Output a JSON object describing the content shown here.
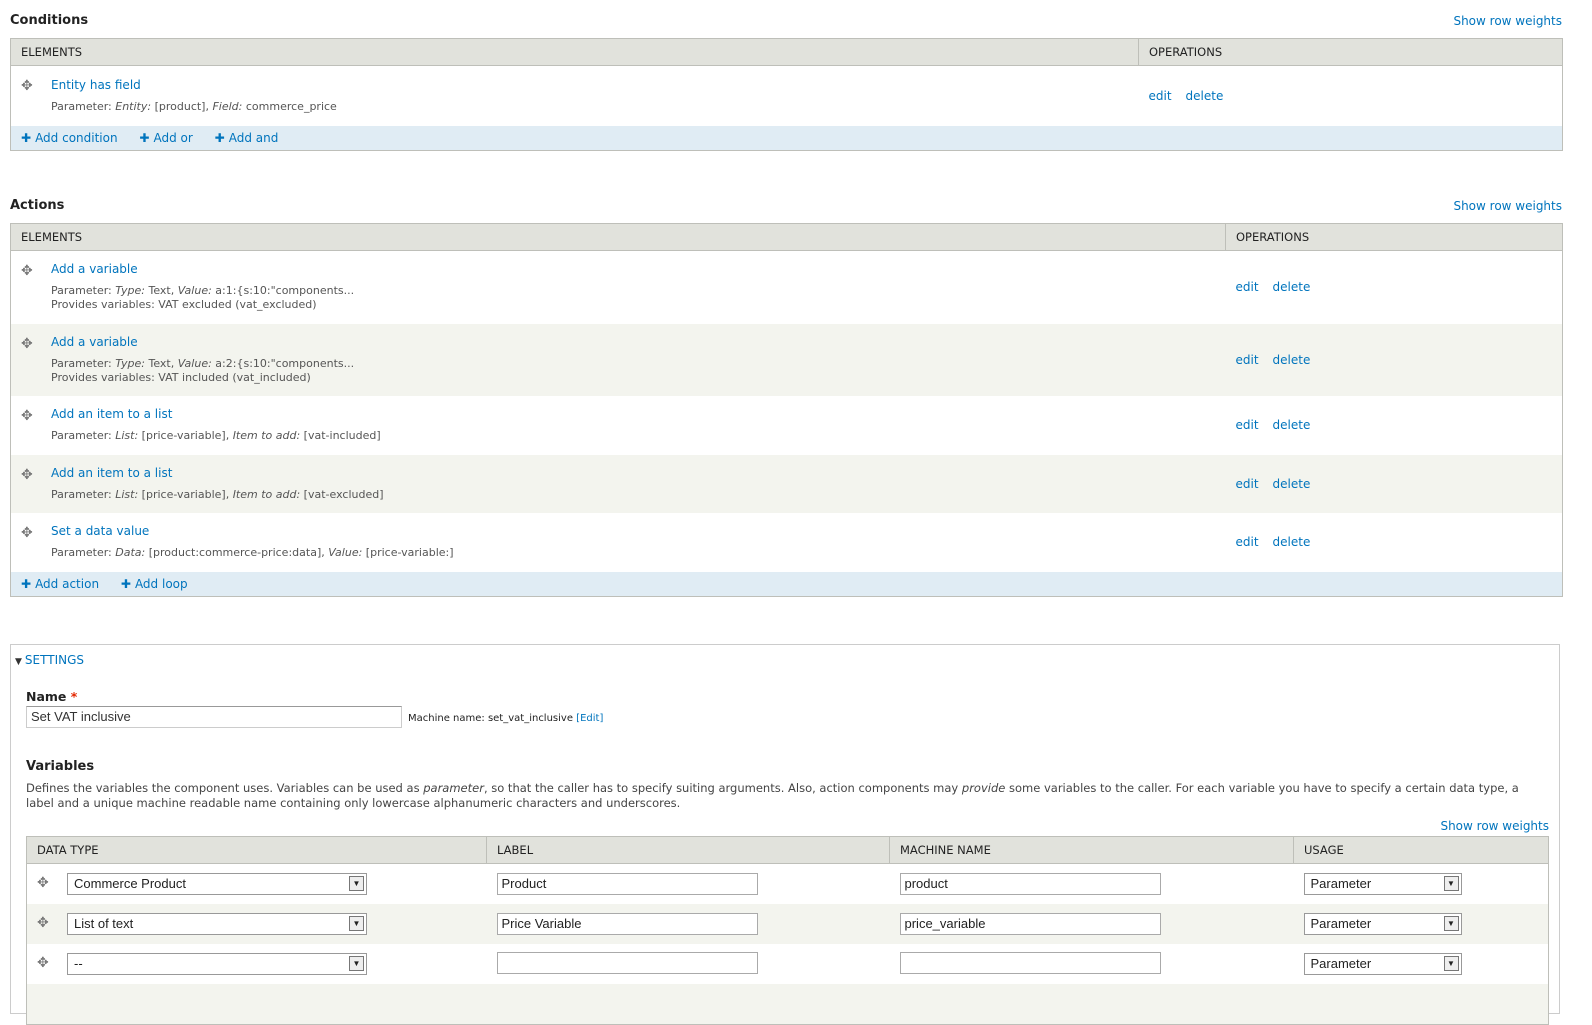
{
  "conditions": {
    "title": "Conditions",
    "row_weights": "Show row weights",
    "headers": {
      "elements": "ELEMENTS",
      "operations": "OPERATIONS"
    },
    "rows": [
      {
        "title": "Entity has field",
        "p1": "Parameter: ",
        "k1": "Entity:",
        "v1": " [product], ",
        "k2": "Field:",
        "v2": " commerce_price",
        "edit": "edit",
        "delete": "delete"
      }
    ],
    "add_links": [
      "Add condition",
      "Add or",
      "Add and"
    ]
  },
  "actions": {
    "title": "Actions",
    "row_weights": "Show row weights",
    "headers": {
      "elements": "ELEMENTS",
      "operations": "OPERATIONS"
    },
    "rows": [
      {
        "title": "Add a variable",
        "p1": "Parameter: ",
        "k1": "Type:",
        "v1": " Text, ",
        "k2": "Value:",
        "v2": " a:1:{s:10:\"components...",
        "provides": "Provides variables: VAT excluded (vat_excluded)",
        "edit": "edit",
        "delete": "delete"
      },
      {
        "title": "Add a variable",
        "p1": "Parameter: ",
        "k1": "Type:",
        "v1": " Text, ",
        "k2": "Value:",
        "v2": " a:2:{s:10:\"components...",
        "provides": "Provides variables: VAT included (vat_included)",
        "edit": "edit",
        "delete": "delete"
      },
      {
        "title": "Add an item to a list",
        "p1": "Parameter: ",
        "k1": "List:",
        "v1": " [price-variable], ",
        "k2": "Item to add:",
        "v2": " [vat-included]",
        "edit": "edit",
        "delete": "delete"
      },
      {
        "title": "Add an item to a list",
        "p1": "Parameter: ",
        "k1": "List:",
        "v1": " [price-variable], ",
        "k2": "Item to add:",
        "v2": " [vat-excluded]",
        "edit": "edit",
        "delete": "delete"
      },
      {
        "title": "Set a data value",
        "p1": "Parameter: ",
        "k1": "Data:",
        "v1": " [product:commerce-price:data], ",
        "k2": "Value:",
        "v2": " [price-variable:]",
        "edit": "edit",
        "delete": "delete"
      }
    ],
    "add_links": [
      "Add action",
      "Add loop"
    ]
  },
  "settings": {
    "legend": "SETTINGS",
    "name_label": "Name",
    "required_mark": "*",
    "name_value": "Set VAT inclusive",
    "machine_prefix": "Machine name: set_vat_inclusive ",
    "machine_edit": "[Edit]",
    "variables_title": "Variables",
    "variables_desc_1": "Defines the variables the component uses. Variables can be used as ",
    "variables_desc_em1": "parameter",
    "variables_desc_2": ", so that the caller has to specify suiting arguments. Also, action components may ",
    "variables_desc_em2": "provide",
    "variables_desc_3": " some variables to the caller. For each variable you have to specify a certain data type, a label and a unique machine readable name containing only lowercase alphanumeric characters and underscores.",
    "row_weights": "Show row weights",
    "headers": {
      "data_type": "DATA TYPE",
      "label": "LABEL",
      "machine_name": "MACHINE NAME",
      "usage": "USAGE"
    },
    "rows": [
      {
        "data_type": "Commerce Product",
        "label": "Product",
        "machine_name": "product",
        "usage": "Parameter"
      },
      {
        "data_type": "List of text",
        "label": "Price Variable",
        "machine_name": "price_variable",
        "usage": "Parameter"
      },
      {
        "data_type": "--",
        "label": "",
        "machine_name": "",
        "usage": "Parameter"
      }
    ]
  },
  "icons": {
    "drag": "move-icon",
    "add": "plus-icon",
    "collapse": "triangle-down-icon",
    "select": "chevron-down-icon"
  }
}
